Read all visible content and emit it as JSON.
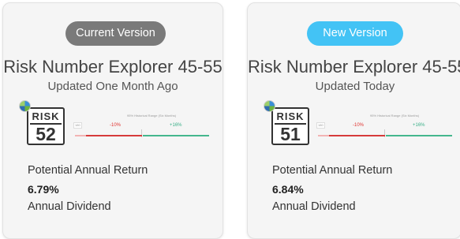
{
  "left_card": {
    "version_label": "Current Version",
    "title": "Risk Number Explorer 45-55",
    "updated": "Updated One Month Ago",
    "risk_word": "RISK",
    "risk_number": "52",
    "range_caption": "95% Historical Range (Six Months)",
    "range_small": "180",
    "range_negative": "-10%",
    "range_positive": "+16%",
    "return_label": "Potential Annual Return",
    "return_value": "6.79%",
    "dividend_label": "Annual Dividend"
  },
  "right_card": {
    "version_label": "New Version",
    "title": "Risk Number Explorer 45-55",
    "updated": "Updated Today",
    "risk_word": "RISK",
    "risk_number": "51",
    "range_caption": "95% Historical Range (Six Months)",
    "range_small": "180",
    "range_negative": "-10%",
    "range_positive": "+16%",
    "return_label": "Potential Annual Return",
    "return_value": "6.84%",
    "dividend_label": "Annual Dividend"
  },
  "colors": {
    "current_pill": "#7a7a7a",
    "new_pill": "#43c3f5",
    "negative": "#d63b3b",
    "positive": "#45b78e"
  }
}
